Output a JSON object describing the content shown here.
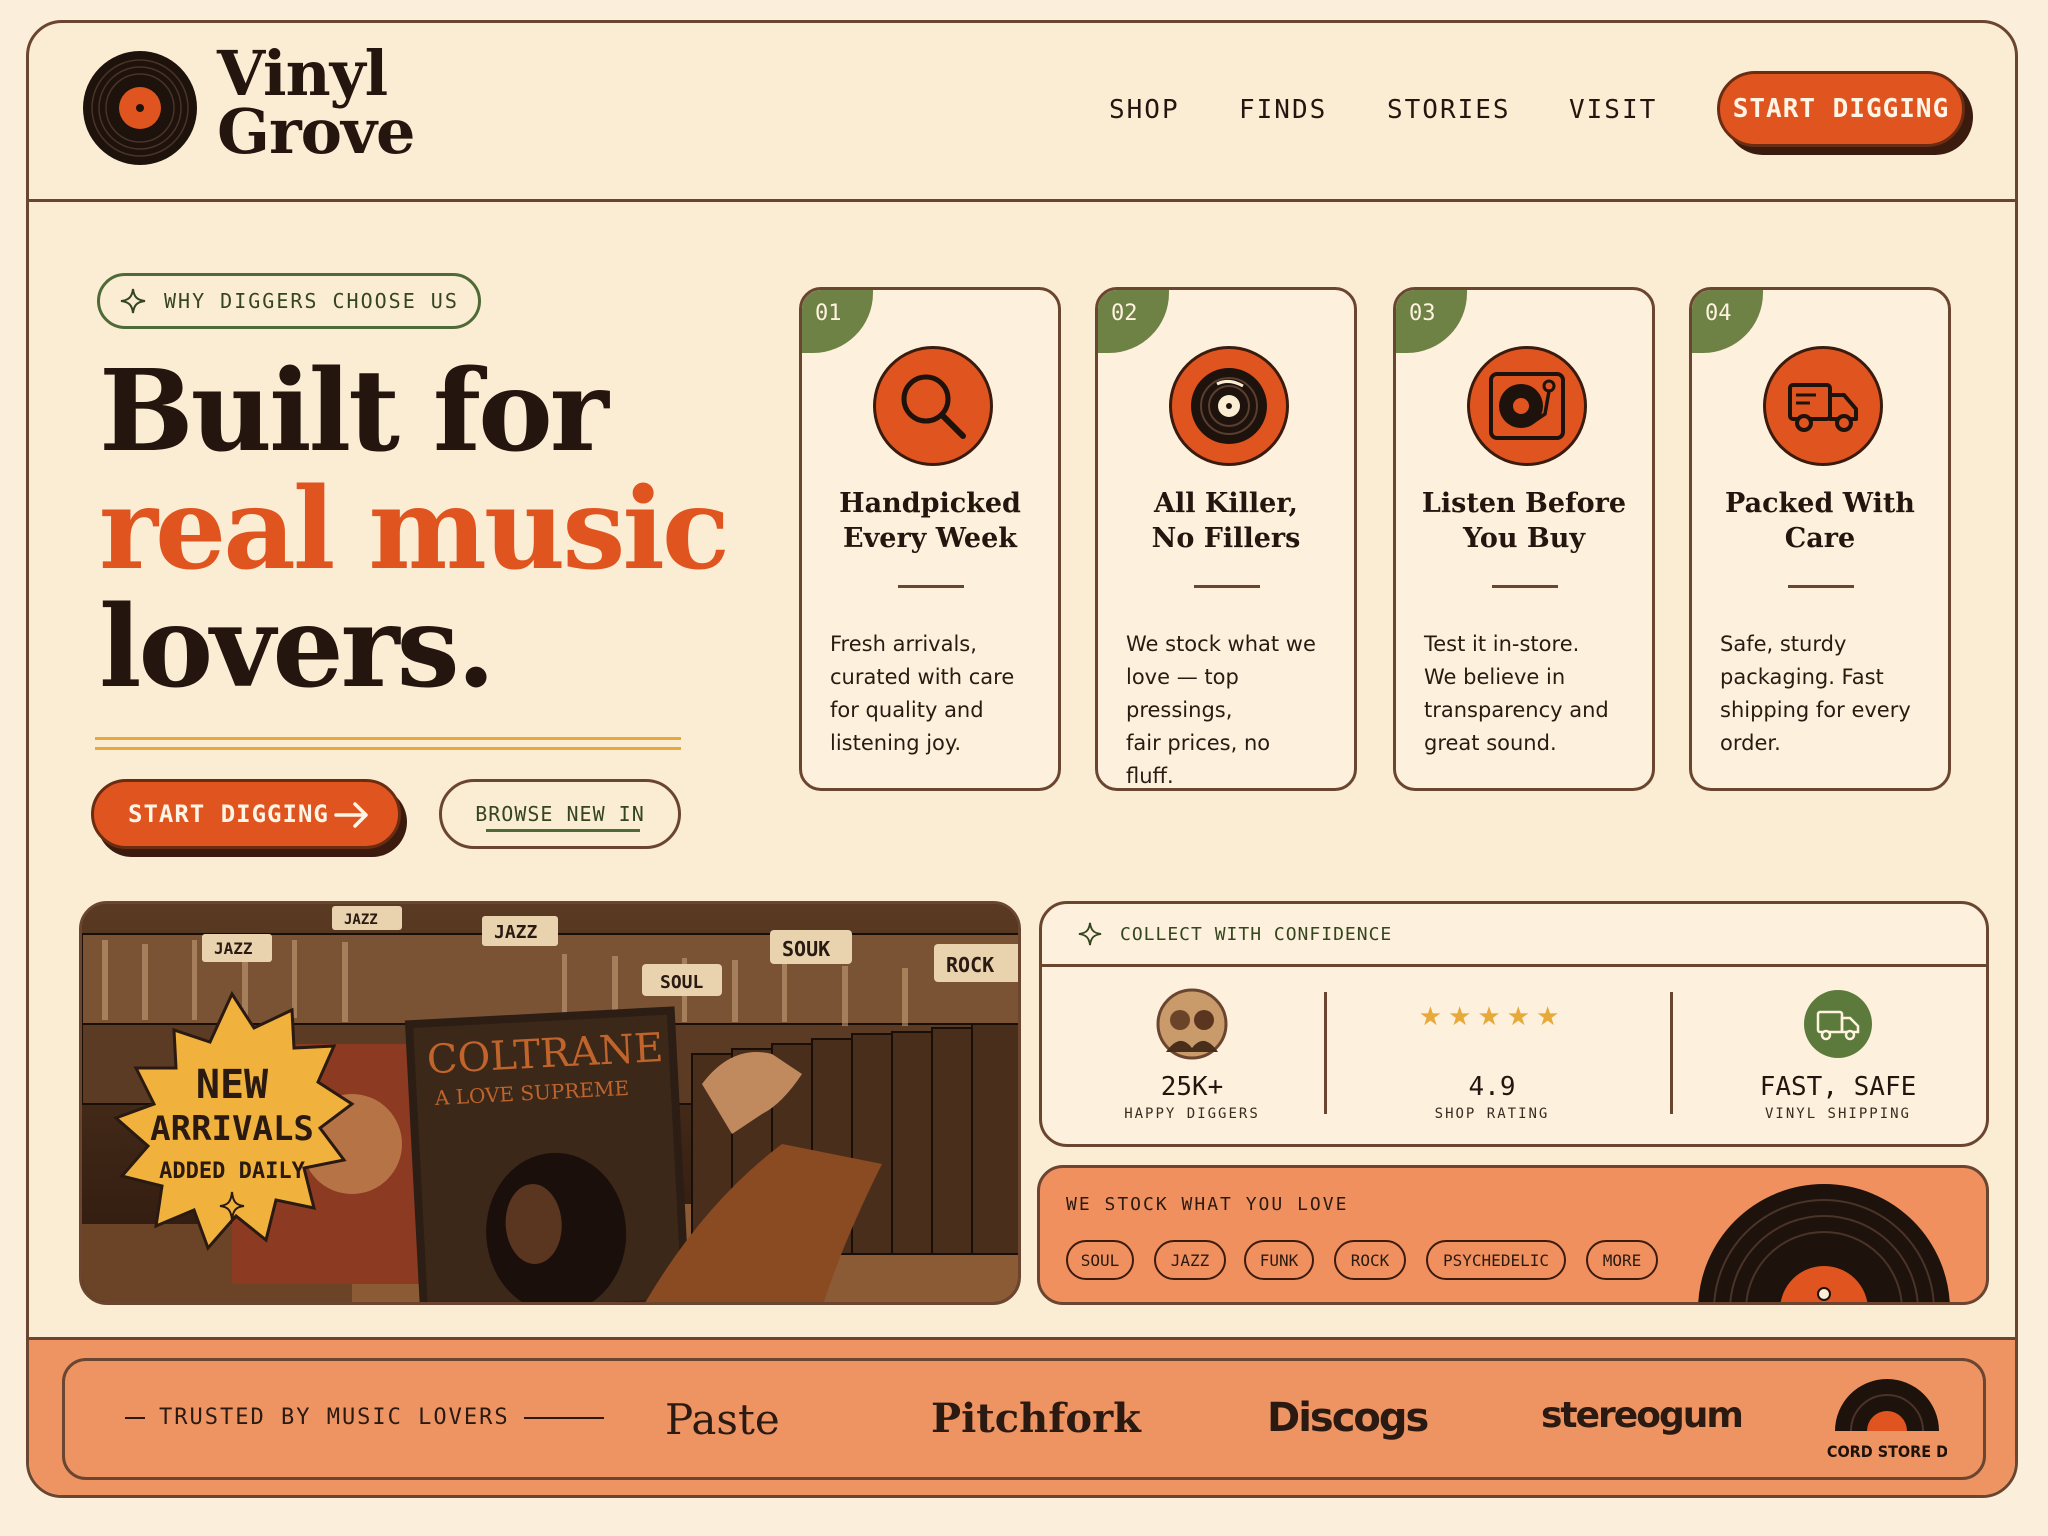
{
  "brand": {
    "name_line1": "Vinyl",
    "name_line2": "Grove"
  },
  "nav": {
    "items": [
      "SHOP",
      "FINDS",
      "STORIES",
      "VISIT"
    ],
    "cta": "START DIGGING"
  },
  "intro": {
    "pill": "WHY DIGGERS CHOOSE US",
    "headline_line1": "Built for",
    "headline_accent": "real music",
    "headline_line3": "lovers.",
    "primary_button": "START DIGGING",
    "secondary_button": "BROWSE NEW IN"
  },
  "features": [
    {
      "num": "01",
      "icon": "search-icon",
      "title1": "Handpicked",
      "title2": "Every Week",
      "body": [
        "Fresh arrivals,",
        "curated with care",
        "for quality and",
        "listening joy."
      ]
    },
    {
      "num": "02",
      "icon": "vinyl-record-icon",
      "title1": "All Killer,",
      "title2": "No Fillers",
      "body": [
        "We stock what we",
        "love — top pressings,",
        "fair prices, no",
        "fluff."
      ]
    },
    {
      "num": "03",
      "icon": "turntable-icon",
      "title1": "Listen Before",
      "title2": "You Buy",
      "body": [
        "Test it in-store.",
        "We believe in",
        "transparency and",
        "great sound."
      ]
    },
    {
      "num": "04",
      "icon": "delivery-truck-icon",
      "title1": "Packed With",
      "title2": "Care",
      "body": [
        "Safe, sturdy",
        "packaging. Fast",
        "shipping for every",
        "order."
      ]
    }
  ],
  "photo": {
    "bin_labels": [
      "JAZZ",
      "JAZZ",
      "JAZZ",
      "SOUK",
      "ROCK",
      "SOUL"
    ],
    "album_title": "COLTRANE",
    "album_subtitle": "A LOVE SUPREME",
    "badge_line1": "NEW",
    "badge_line2": "ARRIVALS",
    "badge_line3": "ADDED DAILY"
  },
  "confidence": {
    "title": "COLLECT WITH CONFIDENCE",
    "stats": [
      {
        "value": "25K+",
        "label": "HAPPY DIGGERS"
      },
      {
        "value": "4.9",
        "label": "SHOP RATING",
        "stars": 5
      },
      {
        "value": "FAST, SAFE",
        "label": "VINYL SHIPPING"
      }
    ]
  },
  "genres": {
    "title": "WE STOCK WHAT YOU LOVE",
    "chips": [
      "SOUL",
      "JAZZ",
      "FUNK",
      "ROCK",
      "PSYCHEDELIC",
      "MORE"
    ]
  },
  "trusted": {
    "label": "TRUSTED BY MUSIC LOVERS",
    "brands": [
      "Paste",
      "Pitchfork",
      "Discogs",
      "stereogum",
      "RECORD STORE DAY"
    ]
  },
  "colors": {
    "accent": "#e0551f",
    "cream": "#fbecd4",
    "ink": "#24150f",
    "olive": "#6f8245",
    "border": "#6a4530",
    "mustard": "#f0b23c"
  }
}
